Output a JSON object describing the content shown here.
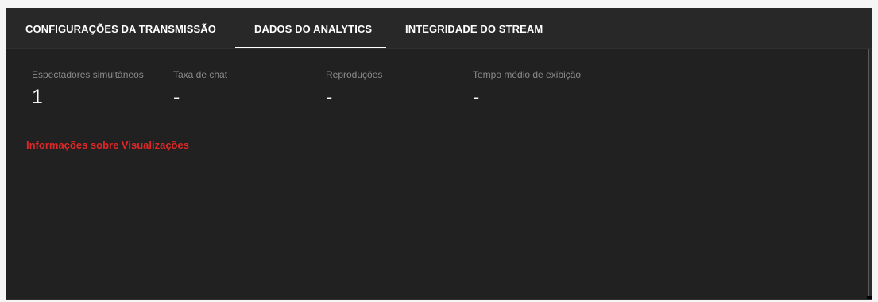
{
  "tabs": [
    {
      "label": "CONFIGURAÇÕES DA TRANSMISSÃO",
      "active": false
    },
    {
      "label": "DADOS DO ANALYTICS",
      "active": true
    },
    {
      "label": "INTEGRIDADE DO STREAM",
      "active": false
    }
  ],
  "stats": [
    {
      "label": "Espectadores simultâneos",
      "value": "1"
    },
    {
      "label": "Taxa de chat",
      "value": "-"
    },
    {
      "label": "Reproduções",
      "value": "-"
    },
    {
      "label": "Tempo médio de exibição",
      "value": "-"
    }
  ],
  "views_info_label": "Informações sobre Visualizações",
  "colors": {
    "panel_bg": "#212121",
    "tab_bar_bg": "#282828",
    "accent_red": "#e02727",
    "label_gray": "#8a8a8a"
  }
}
